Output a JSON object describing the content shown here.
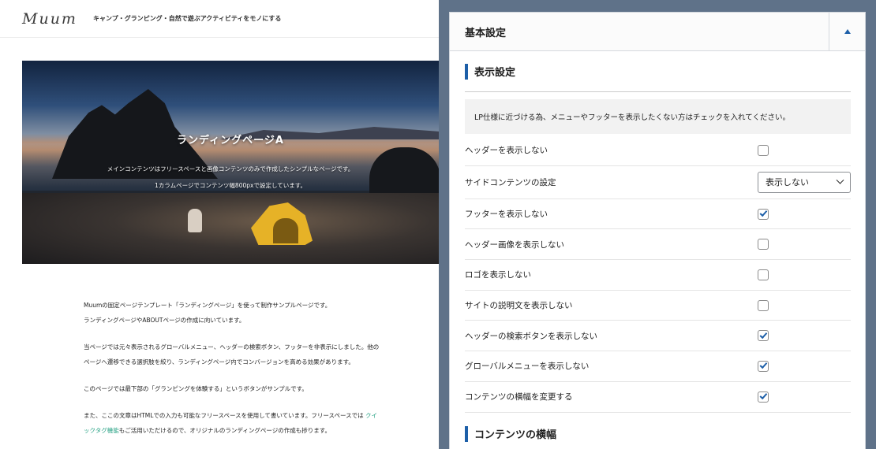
{
  "site": {
    "logo": "Muum",
    "tagline": "キャンプ・グランピング・自然で遊ぶアクティビティをモノにする"
  },
  "hero": {
    "title": "ランディングページA",
    "subtitle1": "メインコンテンツはフリースペースと画像コンテンツのみで作成したシンプルなページです。",
    "subtitle2": "1カラムページでコンテンツ幅800pxで設定しています。"
  },
  "body": {
    "p1a": "Muumの固定ページテンプレート「ランディングページ」を使って制作サンプルページです。",
    "p1b": "ランディングページやABOUTページの作成に向いています。",
    "p2a": "当ページでは元々表示されるグローバルメニュー、ヘッダーの検索ボタン、フッターを非表示にしました。他の",
    "p2b": "ページへ遷移できる選択肢を絞り、ランディングページ内でコンバージョンを高める効果があります。",
    "p3": "このページでは最下部の「グランピングを体験する」というボタンがサンプルです。",
    "p4a": "また、ここの文章はHTMLでの入力も可能なフリースペースを使用して書いています。フリースペースでは",
    "p4link1": "クイ",
    "p4link2": "ックタグ機能",
    "p4b": "もご活用いただけるので、オリジナルのランディングページの作成も捗ります。"
  },
  "panel": {
    "title": "基本設定",
    "section1_title": "表示設定",
    "notice": "LP仕様に近づける為、メニューやフッターを表示したくない方はチェックを入れてください。",
    "rows": [
      {
        "label": "ヘッダーを表示しない",
        "checked": false
      },
      {
        "label": "サイドコンテンツの設定",
        "select": "表示しない"
      },
      {
        "label": "フッターを表示しない",
        "checked": true
      },
      {
        "label": "ヘッダー画像を表示しない",
        "checked": false
      },
      {
        "label": "ロゴを表示しない",
        "checked": false
      },
      {
        "label": "サイトの説明文を表示しない",
        "checked": false
      },
      {
        "label": "ヘッダーの検索ボタンを表示しない",
        "checked": true
      },
      {
        "label": "グローバルメニューを表示しない",
        "checked": true
      },
      {
        "label": "コンテンツの横幅を変更する",
        "checked": true
      }
    ],
    "section2_title": "コンテンツの横幅"
  },
  "colors": {
    "accent": "#1d5fa8",
    "backdrop": "#5f7289",
    "link": "#2aa386"
  },
  "icons": {
    "collapse": "triangle-up-icon",
    "checkbox": "check-icon",
    "select": "chevron-down-icon"
  }
}
